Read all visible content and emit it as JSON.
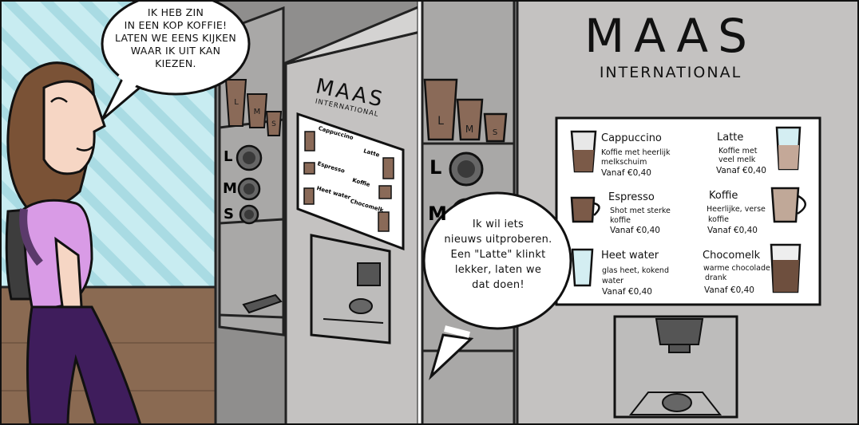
{
  "panel_1": {
    "speech_bubble": {
      "lines": [
        "IK HEB ZIN",
        "IN EEN KOP KOFFIE!",
        "LATEN WE EENS KIJKEN",
        "WAAR IK UIT KAN",
        "KIEZEN."
      ]
    },
    "left_machine": {
      "brand": "MAAS",
      "brand_sub": "INTERNATIONAL",
      "cups": [
        "L",
        "M",
        "S"
      ],
      "size_buttons": [
        "L",
        "M",
        "S"
      ],
      "mini_menu": [
        "Cappuccino",
        "Latte",
        "Espresso",
        "Koffie",
        "Heet water",
        "Chocomelk"
      ]
    }
  },
  "panel_2": {
    "speech_bubble": {
      "lines": [
        "Ik wil iets",
        "nieuws uitproberen.",
        "Een \"Latte\" klinkt",
        "lekker, laten we",
        "dat doen!"
      ]
    },
    "cups": [
      "L",
      "M",
      "S"
    ],
    "size_buttons": [
      "L",
      "M"
    ],
    "machine": {
      "brand": "MAAS",
      "brand_sub": "INTERNATIONAL",
      "menu": [
        {
          "name": "Cappuccino",
          "desc": [
            "Koffie met heerlijk",
            "melkschuim"
          ],
          "price": "Vanaf €0,40"
        },
        {
          "name": "Latte",
          "desc": [
            "Koffie met",
            "veel melk"
          ],
          "price": "Vanaf €0,40"
        },
        {
          "name": "Espresso",
          "desc": [
            "Shot met sterke",
            "koffie"
          ],
          "price": "Vanaf €0,40"
        },
        {
          "name": "Koffie",
          "desc": [
            "Heerlijke, verse",
            "koffie"
          ],
          "price": "Vanaf €0,40"
        },
        {
          "name": "Heet water",
          "desc": [
            "glas heet, kokend",
            "water"
          ],
          "price": "Vanaf €0,40"
        },
        {
          "name": "Chocomelk",
          "desc": [
            "warme chocolade",
            "drank"
          ],
          "price": "Vanaf €0,40"
        }
      ]
    }
  },
  "colors": {
    "wall_blue": "#bfe6ec",
    "floor_brown": "#8a6a52",
    "machine_gray": "#c4c2c1",
    "wall_gray": "#9b9a99",
    "shirt_purple": "#d99be6",
    "pants_purple": "#3f1d5c",
    "hair_brown": "#7a5236",
    "coffee_brown": "#7b5a48"
  }
}
